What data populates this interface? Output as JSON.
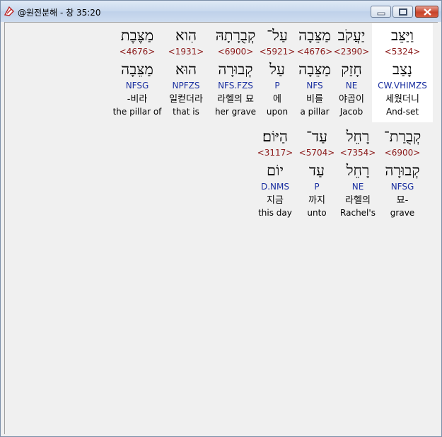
{
  "window": {
    "title": "@원전분해 - 창 35:20"
  },
  "rows": [
    [
      {
        "hebrew": "וַיַּצֵּב",
        "strong": "<5324>",
        "lemma": "נָצַב",
        "morph": "CW.VHIMZS",
        "korean": "세웠더니",
        "english": "And-set",
        "highlighted": true
      },
      {
        "hebrew": "יַעֲקֹב",
        "strong": "<2390>",
        "lemma": "חָזַק",
        "morph": "NE",
        "korean": "야곱이",
        "english": "Jacob",
        "highlighted": false
      },
      {
        "hebrew": "מַצֵּבָה",
        "strong": "<4676>",
        "lemma": "מַצֵּבָה",
        "morph": "NFS",
        "korean": "비를",
        "english": "a pillar",
        "highlighted": false
      },
      {
        "hebrew": "עַל־",
        "strong": "<5921>",
        "lemma": "עַל",
        "morph": "P",
        "korean": "에",
        "english": "upon",
        "highlighted": false
      },
      {
        "hebrew": "קְבֻרָתָהּ",
        "strong": "<6900>",
        "lemma": "קְבוּרָה",
        "morph": "NFS.FZS",
        "korean": "라헬의 묘",
        "english": "her grave",
        "highlighted": false
      },
      {
        "hebrew": "הִוא",
        "strong": "<1931>",
        "lemma": "הוּא",
        "morph": "NPFZS",
        "korean": "일컫더라",
        "english": "that is",
        "highlighted": false
      },
      {
        "hebrew": "מַצֶּבֶת",
        "strong": "<4676>",
        "lemma": "מַצֵּבָה",
        "morph": "NFSG",
        "korean": "-비라",
        "english": "the pillar of",
        "highlighted": false
      }
    ],
    [
      {
        "hebrew": "קְבֻרַת־",
        "strong": "<6900>",
        "lemma": "קְבוּרָה",
        "morph": "NFSG",
        "korean": "묘-",
        "english": "grave",
        "highlighted": false
      },
      {
        "hebrew": "רָחֵל",
        "strong": "<7354>",
        "lemma": "רָחֵל",
        "morph": "NE",
        "korean": "라헬의",
        "english": "Rachel's",
        "highlighted": false
      },
      {
        "hebrew": "עַד־",
        "strong": "<5704>",
        "lemma": "עַד",
        "morph": "P",
        "korean": "까지",
        "english": "unto",
        "highlighted": false
      },
      {
        "hebrew": "הַיּוֹם׃",
        "strong": "<3117>",
        "lemma": "יוֹם",
        "morph": "D.NMS",
        "korean": "지금",
        "english": "this day",
        "highlighted": false
      }
    ]
  ]
}
